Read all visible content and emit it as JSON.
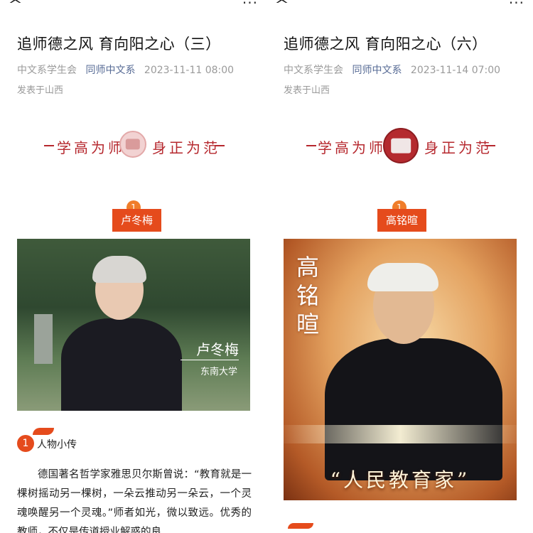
{
  "left": {
    "title": "追师德之风 育向阳之心（三）",
    "account_prefix": "中文系学生会",
    "account_name": "同师中文系",
    "datetime": "2023-11-11 08:00",
    "location": "发表于山西",
    "banner_left": "学高为师",
    "banner_right": "身正为范",
    "badge_number": "1",
    "person_name": "卢冬梅",
    "photo_caption_name": "卢冬梅",
    "photo_caption_school": "东南大学",
    "section_number": "1",
    "section_title": "人物小传",
    "body_text": "德国著名哲学家雅思贝尔斯曾说：“教育就是一棵树摇动另一棵树，一朵云推动另一朵云，一个灵魂唤醒另一个灵魂。”师者如光，微以致远。优秀的教师，不仅是传道授业解惑的良"
  },
  "right": {
    "title": "追师德之风 育向阳之心（六）",
    "account_prefix": "中文系学生会",
    "account_name": "同师中文系",
    "datetime": "2023-11-14 07:00",
    "location": "发表于山西",
    "banner_left": "学高为师",
    "banner_right": "身正为范",
    "badge_number": "1",
    "person_name": "高铭暄",
    "photo_vertical_name": "高铭暄",
    "photo_quote": "“人民教育家”"
  },
  "icons": {
    "back": "chevron-up-icon",
    "more": "more-dots-icon"
  },
  "colors": {
    "accent": "#e54b1c",
    "seal": "#b6282e",
    "link": "#576b95",
    "meta": "#9a9a9a"
  }
}
